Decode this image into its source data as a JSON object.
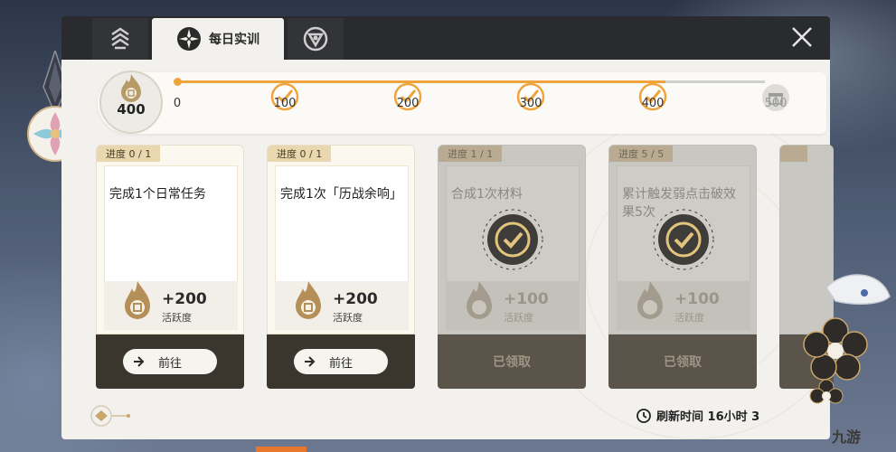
{
  "tabs": [
    {
      "icon": "emblem-icon"
    },
    {
      "icon": "daily-training-icon",
      "label": "每日实训"
    },
    {
      "icon": "gear-triangle-icon"
    }
  ],
  "activity": {
    "current": "400",
    "milestones": [
      {
        "label": "0",
        "state": "start"
      },
      {
        "label": "100",
        "state": "done"
      },
      {
        "label": "200",
        "state": "done"
      },
      {
        "label": "300",
        "state": "done"
      },
      {
        "label": "400",
        "state": "done"
      },
      {
        "label": "500",
        "state": "locked"
      }
    ]
  },
  "cards": [
    {
      "progress": "进度  0 / 1",
      "title": "完成1个日常任务",
      "reward": "+200",
      "reward_label": "活跃度",
      "action": "前往",
      "claimed": false
    },
    {
      "progress": "进度  0 / 1",
      "title": "完成1次「历战余响」",
      "reward": "+200",
      "reward_label": "活跃度",
      "action": "前往",
      "claimed": false
    },
    {
      "progress": "进度  1 / 1",
      "title": "合成1次材料",
      "reward": "+100",
      "reward_label": "活跃度",
      "action": "已领取",
      "claimed": true
    },
    {
      "progress": "进度  5 / 5",
      "title": "累计触发弱点击破效果5次",
      "reward": "+100",
      "reward_label": "活跃度",
      "action": "已领取",
      "claimed": true
    }
  ],
  "refresh_text": "刷新时间 16小时 3",
  "watermark": "九游",
  "colors": {
    "accent": "#f0a43c",
    "dark": "#2a2b2e",
    "panel": "#f2f1ee"
  }
}
